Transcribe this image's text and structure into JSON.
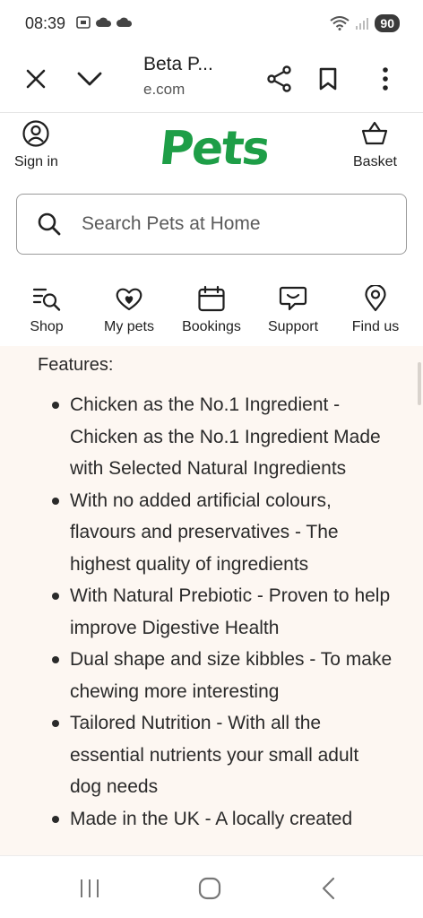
{
  "status": {
    "time": "08:39",
    "battery": "90"
  },
  "browser": {
    "title": "Beta P...",
    "url": "e.com"
  },
  "header": {
    "sign_in": "Sign in",
    "logo": "Pets",
    "basket": "Basket"
  },
  "search": {
    "placeholder": "Search Pets at Home"
  },
  "nav": {
    "items": [
      {
        "label": "Shop"
      },
      {
        "label": "My pets"
      },
      {
        "label": "Bookings"
      },
      {
        "label": "Support"
      },
      {
        "label": "Find us"
      }
    ]
  },
  "content": {
    "features_title": "Features:",
    "features": [
      "Chicken as the No.1 Ingredient - Chicken as the No.1 Ingredient Made with Selected Natural Ingredients",
      "With no added artificial colours, flavours and preservatives - The highest quality of ingredients",
      "With Natural Prebiotic - Proven to help improve Digestive Health",
      "Dual shape and size kibbles - To make chewing more interesting",
      "Tailored Nutrition - With all the essential nutrients your small adult dog needs",
      "Made in the UK - A locally created"
    ]
  },
  "colors": {
    "brand_green": "#1e9e47",
    "content_bg": "#fdf7f2"
  }
}
